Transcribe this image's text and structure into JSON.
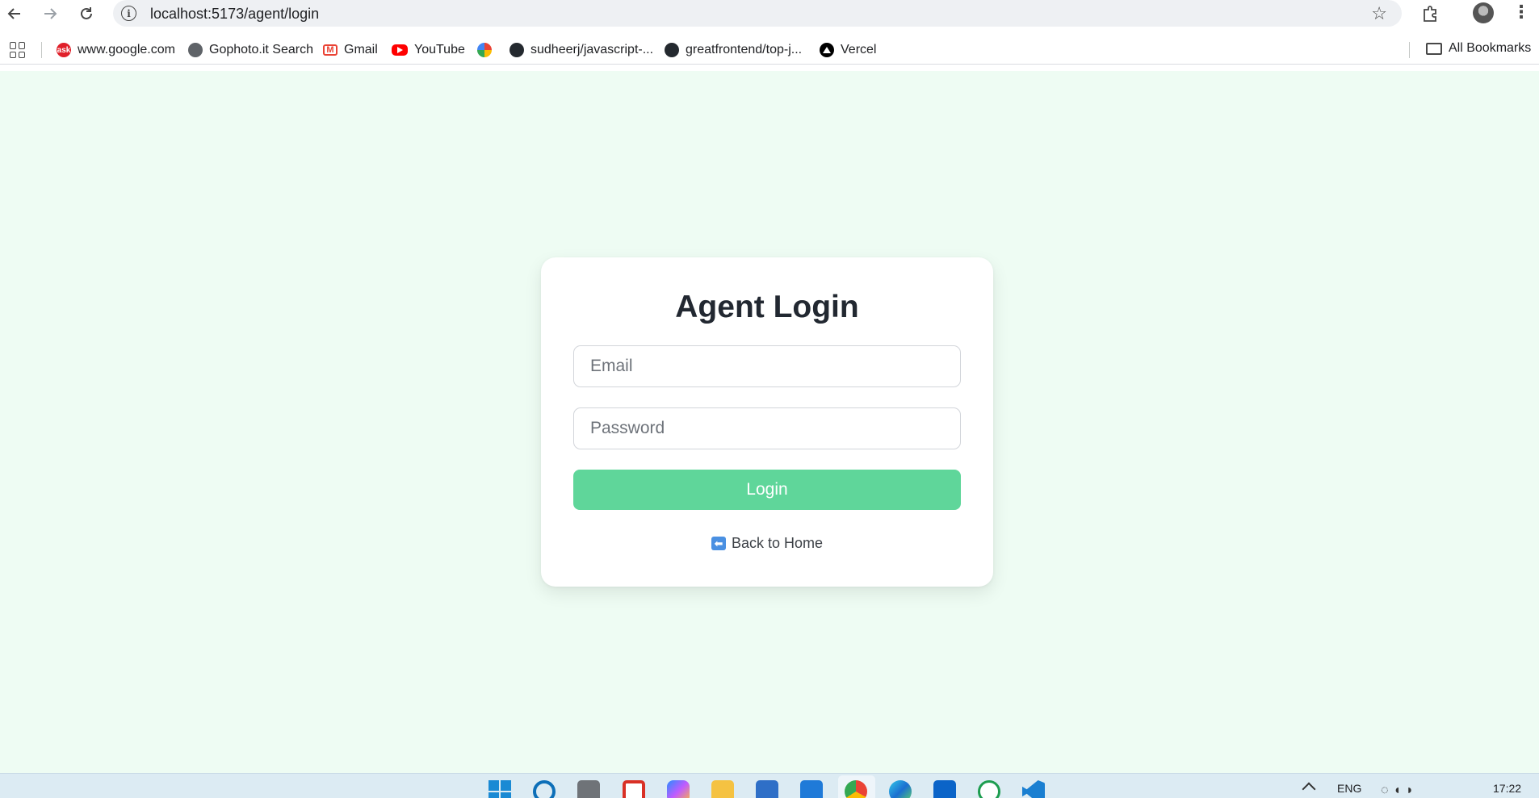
{
  "browser": {
    "url": "localhost:5173/agent/login",
    "back_icon": "arrow-left-icon",
    "forward_icon": "arrow-right-icon",
    "reload_icon": "reload-icon",
    "menu_glyph": "⋮"
  },
  "bookmarks": {
    "items": [
      {
        "label": "www.google.com",
        "icon": "ask-icon"
      },
      {
        "label": "Gophoto.it Search",
        "icon": "globe-icon"
      },
      {
        "label": "Gmail",
        "icon": "gmail-icon"
      },
      {
        "label": "YouTube",
        "icon": "youtube-icon"
      },
      {
        "label": "",
        "icon": "photos-icon"
      },
      {
        "label": "sudheerj/javascript-...",
        "icon": "github-icon"
      },
      {
        "label": "greatfrontend/top-j...",
        "icon": "github-icon"
      },
      {
        "label": "Vercel",
        "icon": "vercel-icon"
      }
    ],
    "all_bookmarks_label": "All Bookmarks"
  },
  "login": {
    "title": "Agent Login",
    "email_placeholder": "Email",
    "password_placeholder": "Password",
    "submit_label": "Login",
    "back_label": "Back to Home",
    "back_glyph": "⬅"
  },
  "taskbar": {
    "language": "ENG",
    "time": "17:22"
  },
  "colors": {
    "page_background": "#eefcf3",
    "button": "#5fd69a",
    "title": "#222831"
  }
}
